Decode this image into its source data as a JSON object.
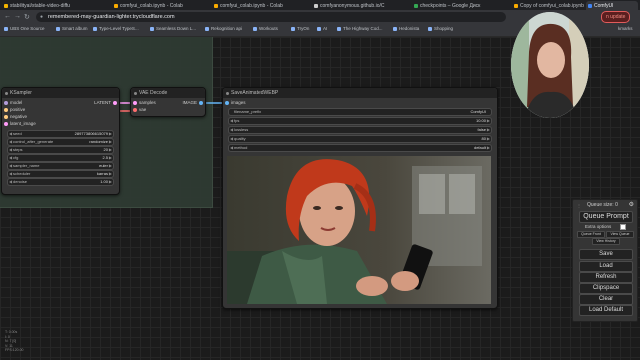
{
  "browser": {
    "tabs": [
      {
        "title": "stabilityai/stable-video-diffu",
        "icon": "huggingface-icon",
        "color": "#f4b400"
      },
      {
        "title": "comfyui_colab.ipynb - Colab",
        "icon": "colab-icon",
        "color": "#f9ab00"
      },
      {
        "title": "comfyui_colab.ipynb - Colab",
        "icon": "colab-icon",
        "color": "#f9ab00"
      },
      {
        "title": "comfyanonymous.github.io/C",
        "icon": "github-icon",
        "color": "#cccccc"
      },
      {
        "title": "checkpoints – Google Диск",
        "icon": "drive-icon",
        "color": "#34a853"
      },
      {
        "title": "Copy of comfyui_colab.ipynb",
        "icon": "colab-icon",
        "color": "#f9ab00"
      },
      {
        "title": "ComfyUI",
        "icon": "comfy-icon",
        "color": "#4285f4",
        "active": true
      }
    ],
    "url": "remembered-may-guardian-lighter.trycloudflare.com",
    "update_label": "n update",
    "bookmarks": [
      "UBS One Source",
      "Smart album",
      "Type-Level TypeS...",
      "Seamless Down L...",
      "Rekognition api",
      "Workouts",
      "TryOn",
      "AI",
      "The Highway Cod...",
      "Hedonista",
      "Shopping"
    ],
    "bookmarks_overflow": "kmarks"
  },
  "nodes": {
    "ksampler": {
      "title": "KSampler",
      "inputs": [
        "model",
        "positive",
        "negative",
        "latent_image"
      ],
      "output": "LATENT",
      "widgets": [
        {
          "label": "seed",
          "value": "289773806615079"
        },
        {
          "label": "control_after_generate",
          "value": "randomize"
        },
        {
          "label": "steps",
          "value": "20"
        },
        {
          "label": "cfg",
          "value": "2.5"
        },
        {
          "label": "sampler_name",
          "value": "euler"
        },
        {
          "label": "scheduler",
          "value": "karras"
        },
        {
          "label": "denoise",
          "value": "1.00"
        }
      ]
    },
    "vae_decode": {
      "title": "VAE Decode",
      "inputs": [
        "samples",
        "vae"
      ],
      "output": "IMAGE"
    },
    "save_webp": {
      "title": "SaveAnimatedWEBP",
      "input": "images",
      "widgets": [
        {
          "label": "filename_prefix",
          "value": "ComfyUI"
        },
        {
          "label": "fps",
          "value": "10.00"
        },
        {
          "label": "lossless",
          "value": "false"
        },
        {
          "label": "quality",
          "value": "80"
        },
        {
          "label": "method",
          "value": "default"
        }
      ]
    }
  },
  "queue": {
    "size_label": "Queue size: 0",
    "queue_prompt": "Queue Prompt",
    "extra_options": "Extra options",
    "queue_front": "Queue Front",
    "view_queue": "View Queue",
    "view_history": "View History",
    "buttons": [
      "Save",
      "Load",
      "Refresh",
      "Clipspace",
      "Clear",
      "Load Default"
    ]
  },
  "stats": [
    "T: 0.00s",
    "I: 0",
    "N: 7 [0]",
    "V: 11",
    "FPS:120.00"
  ],
  "colors": {
    "model": "#b39ddb",
    "positive": "#ffcc80",
    "negative": "#ffcc80",
    "latent": "#ff9cf9",
    "vae": "#ff6e6e",
    "image": "#64b5f6"
  }
}
